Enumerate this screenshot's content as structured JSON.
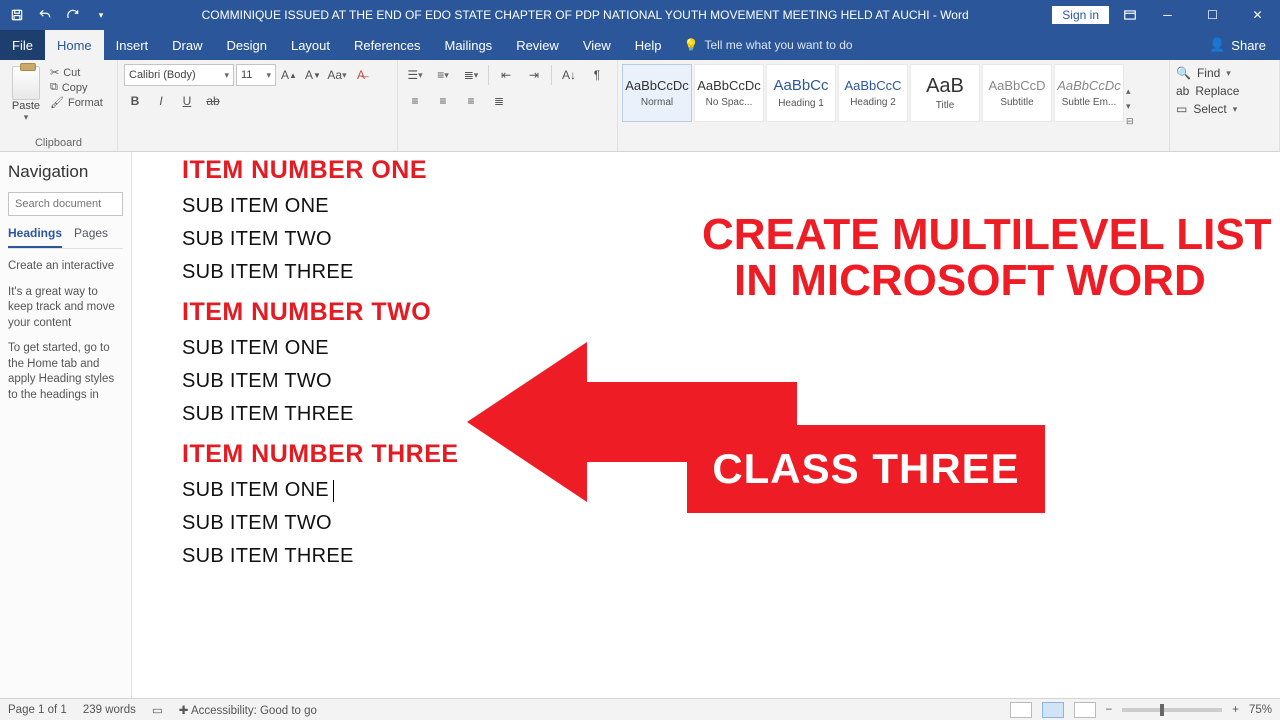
{
  "titlebar": {
    "doc_title": "COMMINIQUE ISSUED AT THE END OF EDO STATE CHAPTER OF PDP NATIONAL YOUTH MOVEMENT MEETING HELD AT AUCHI  -  Word",
    "signin": "Sign in"
  },
  "tabs": {
    "file": "File",
    "home": "Home",
    "insert": "Insert",
    "draw": "Draw",
    "design": "Design",
    "layout": "Layout",
    "references": "References",
    "mailings": "Mailings",
    "review": "Review",
    "view": "View",
    "help": "Help",
    "tellme": "Tell me what you want to do",
    "share": "Share"
  },
  "clipboard": {
    "paste": "Paste",
    "cut": "Cut",
    "copy": "Copy",
    "format": "Format",
    "label": "Clipboard"
  },
  "font": {
    "name": "Calibri (Body)",
    "size": "11"
  },
  "styles": {
    "s1": {
      "sample": "AaBbCcDc",
      "name": "Normal"
    },
    "s2": {
      "sample": "AaBbCcDc",
      "name": "No Spac..."
    },
    "s3": {
      "sample": "AaBbCc",
      "name": "Heading 1"
    },
    "s4": {
      "sample": "AaBbCcC",
      "name": "Heading 2"
    },
    "s5": {
      "sample": "AaB",
      "name": "Title"
    },
    "s6": {
      "sample": "AaBbCcD",
      "name": "Subtitle"
    },
    "s7": {
      "sample": "AaBbCcDc",
      "name": "Subtle Em..."
    }
  },
  "editing": {
    "find": "Find",
    "replace": "Replace",
    "select": "Select"
  },
  "nav": {
    "title": "Navigation",
    "search_ph": "Search document",
    "tab_headings": "Headings",
    "tab_pages": "Pages",
    "p1": "Create an interactive",
    "p2": "It's a great way to keep track and move your content",
    "p3": "To get started, go to the Home tab and apply Heading styles to the headings in"
  },
  "doc": {
    "h1": "ITEM NUMBER ONE",
    "h2": "ITEM NUMBER TWO",
    "h3": "ITEM NUMBER THREE",
    "s1": "SUB ITEM ONE",
    "s2": "SUB ITEM TWO",
    "s3": "SUB ITEM THREE"
  },
  "overlay": {
    "line1": "CREATE MULTILEVEL LIST",
    "line2": "IN MICROSOFT WORD",
    "badge": "CLASS THREE"
  },
  "status": {
    "page": "Page 1 of 1",
    "words": "239 words",
    "access": "Accessibility: Good to go",
    "zoom": "75%"
  }
}
